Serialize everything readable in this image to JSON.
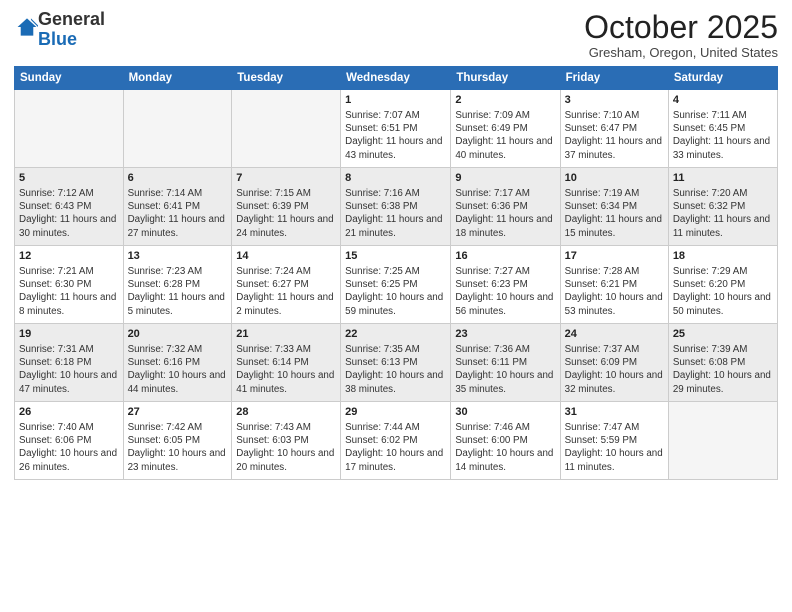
{
  "header": {
    "logo_general": "General",
    "logo_blue": "Blue",
    "month_title": "October 2025",
    "subtitle": "Gresham, Oregon, United States"
  },
  "days_of_week": [
    "Sunday",
    "Monday",
    "Tuesday",
    "Wednesday",
    "Thursday",
    "Friday",
    "Saturday"
  ],
  "weeks": [
    [
      {
        "day": "",
        "info": ""
      },
      {
        "day": "",
        "info": ""
      },
      {
        "day": "",
        "info": ""
      },
      {
        "day": "1",
        "info": "Sunrise: 7:07 AM\nSunset: 6:51 PM\nDaylight: 11 hours and 43 minutes."
      },
      {
        "day": "2",
        "info": "Sunrise: 7:09 AM\nSunset: 6:49 PM\nDaylight: 11 hours and 40 minutes."
      },
      {
        "day": "3",
        "info": "Sunrise: 7:10 AM\nSunset: 6:47 PM\nDaylight: 11 hours and 37 minutes."
      },
      {
        "day": "4",
        "info": "Sunrise: 7:11 AM\nSunset: 6:45 PM\nDaylight: 11 hours and 33 minutes."
      }
    ],
    [
      {
        "day": "5",
        "info": "Sunrise: 7:12 AM\nSunset: 6:43 PM\nDaylight: 11 hours and 30 minutes."
      },
      {
        "day": "6",
        "info": "Sunrise: 7:14 AM\nSunset: 6:41 PM\nDaylight: 11 hours and 27 minutes."
      },
      {
        "day": "7",
        "info": "Sunrise: 7:15 AM\nSunset: 6:39 PM\nDaylight: 11 hours and 24 minutes."
      },
      {
        "day": "8",
        "info": "Sunrise: 7:16 AM\nSunset: 6:38 PM\nDaylight: 11 hours and 21 minutes."
      },
      {
        "day": "9",
        "info": "Sunrise: 7:17 AM\nSunset: 6:36 PM\nDaylight: 11 hours and 18 minutes."
      },
      {
        "day": "10",
        "info": "Sunrise: 7:19 AM\nSunset: 6:34 PM\nDaylight: 11 hours and 15 minutes."
      },
      {
        "day": "11",
        "info": "Sunrise: 7:20 AM\nSunset: 6:32 PM\nDaylight: 11 hours and 11 minutes."
      }
    ],
    [
      {
        "day": "12",
        "info": "Sunrise: 7:21 AM\nSunset: 6:30 PM\nDaylight: 11 hours and 8 minutes."
      },
      {
        "day": "13",
        "info": "Sunrise: 7:23 AM\nSunset: 6:28 PM\nDaylight: 11 hours and 5 minutes."
      },
      {
        "day": "14",
        "info": "Sunrise: 7:24 AM\nSunset: 6:27 PM\nDaylight: 11 hours and 2 minutes."
      },
      {
        "day": "15",
        "info": "Sunrise: 7:25 AM\nSunset: 6:25 PM\nDaylight: 10 hours and 59 minutes."
      },
      {
        "day": "16",
        "info": "Sunrise: 7:27 AM\nSunset: 6:23 PM\nDaylight: 10 hours and 56 minutes."
      },
      {
        "day": "17",
        "info": "Sunrise: 7:28 AM\nSunset: 6:21 PM\nDaylight: 10 hours and 53 minutes."
      },
      {
        "day": "18",
        "info": "Sunrise: 7:29 AM\nSunset: 6:20 PM\nDaylight: 10 hours and 50 minutes."
      }
    ],
    [
      {
        "day": "19",
        "info": "Sunrise: 7:31 AM\nSunset: 6:18 PM\nDaylight: 10 hours and 47 minutes."
      },
      {
        "day": "20",
        "info": "Sunrise: 7:32 AM\nSunset: 6:16 PM\nDaylight: 10 hours and 44 minutes."
      },
      {
        "day": "21",
        "info": "Sunrise: 7:33 AM\nSunset: 6:14 PM\nDaylight: 10 hours and 41 minutes."
      },
      {
        "day": "22",
        "info": "Sunrise: 7:35 AM\nSunset: 6:13 PM\nDaylight: 10 hours and 38 minutes."
      },
      {
        "day": "23",
        "info": "Sunrise: 7:36 AM\nSunset: 6:11 PM\nDaylight: 10 hours and 35 minutes."
      },
      {
        "day": "24",
        "info": "Sunrise: 7:37 AM\nSunset: 6:09 PM\nDaylight: 10 hours and 32 minutes."
      },
      {
        "day": "25",
        "info": "Sunrise: 7:39 AM\nSunset: 6:08 PM\nDaylight: 10 hours and 29 minutes."
      }
    ],
    [
      {
        "day": "26",
        "info": "Sunrise: 7:40 AM\nSunset: 6:06 PM\nDaylight: 10 hours and 26 minutes."
      },
      {
        "day": "27",
        "info": "Sunrise: 7:42 AM\nSunset: 6:05 PM\nDaylight: 10 hours and 23 minutes."
      },
      {
        "day": "28",
        "info": "Sunrise: 7:43 AM\nSunset: 6:03 PM\nDaylight: 10 hours and 20 minutes."
      },
      {
        "day": "29",
        "info": "Sunrise: 7:44 AM\nSunset: 6:02 PM\nDaylight: 10 hours and 17 minutes."
      },
      {
        "day": "30",
        "info": "Sunrise: 7:46 AM\nSunset: 6:00 PM\nDaylight: 10 hours and 14 minutes."
      },
      {
        "day": "31",
        "info": "Sunrise: 7:47 AM\nSunset: 5:59 PM\nDaylight: 10 hours and 11 minutes."
      },
      {
        "day": "",
        "info": ""
      }
    ]
  ]
}
